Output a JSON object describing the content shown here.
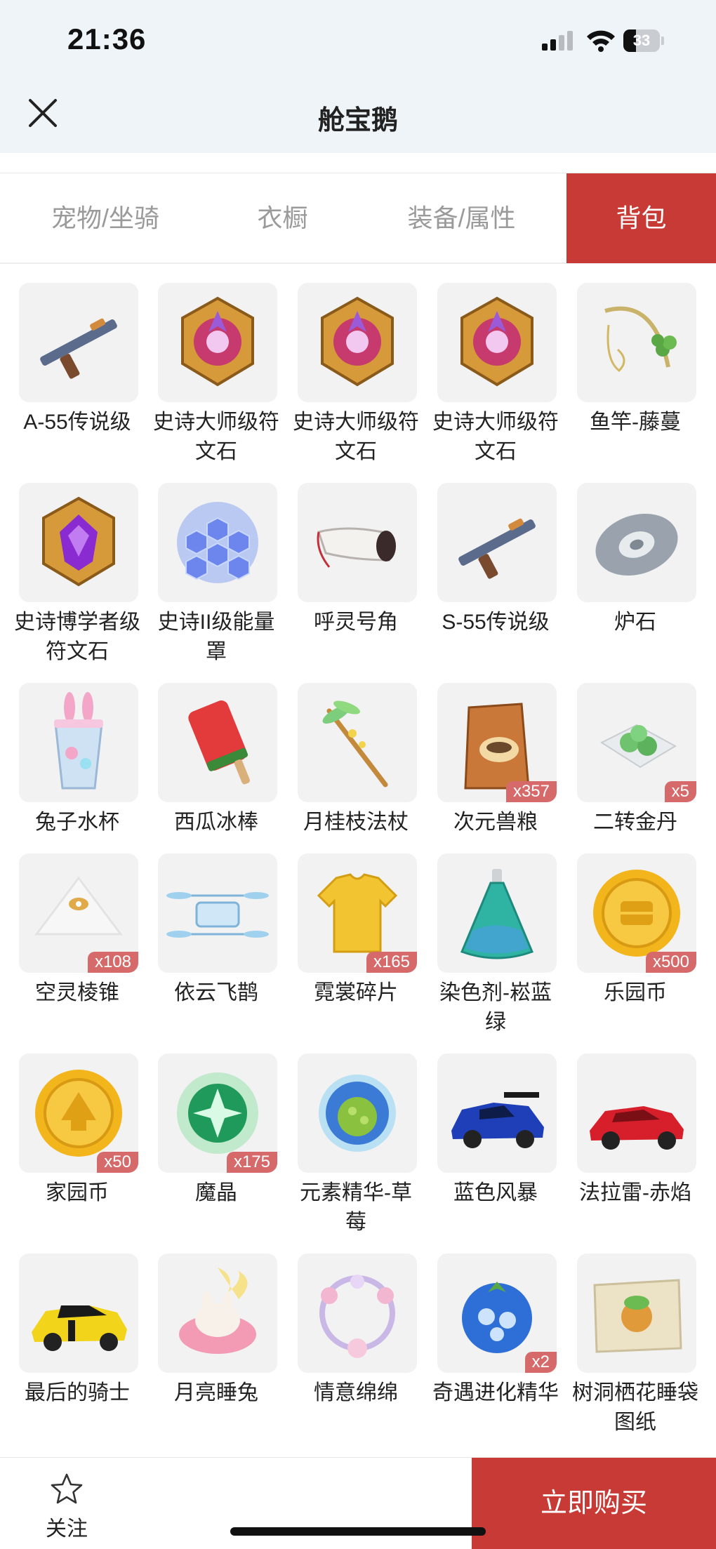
{
  "status": {
    "time": "21:36",
    "battery": "33"
  },
  "header": {
    "title": "舱宝鹅"
  },
  "tabs": [
    {
      "label": "宠物/坐骑",
      "active": false
    },
    {
      "label": "衣橱",
      "active": false
    },
    {
      "label": "装备/属性",
      "active": false
    },
    {
      "label": "背包",
      "active": true
    }
  ],
  "items": [
    {
      "name": "A-55传说级",
      "icon": "gun-icon",
      "badge": ""
    },
    {
      "name": "史诗大师级符文石",
      "icon": "rune-stone-icon",
      "badge": ""
    },
    {
      "name": "史诗大师级符文石",
      "icon": "rune-stone-icon",
      "badge": ""
    },
    {
      "name": "史诗大师级符文石",
      "icon": "rune-stone-icon",
      "badge": ""
    },
    {
      "name": "鱼竿-藤蔓",
      "icon": "fishing-rod-icon",
      "badge": ""
    },
    {
      "name": "史诗博学者级符文石",
      "icon": "purple-rune-icon",
      "badge": ""
    },
    {
      "name": "史诗II级能量罩",
      "icon": "energy-shield-icon",
      "badge": ""
    },
    {
      "name": "呼灵号角",
      "icon": "horn-icon",
      "badge": ""
    },
    {
      "name": "S-55传说级",
      "icon": "gun-icon",
      "badge": ""
    },
    {
      "name": "炉石",
      "icon": "hearthstone-icon",
      "badge": ""
    },
    {
      "name": "兔子水杯",
      "icon": "bunny-cup-icon",
      "badge": ""
    },
    {
      "name": "西瓜冰棒",
      "icon": "popsicle-icon",
      "badge": ""
    },
    {
      "name": "月桂枝法杖",
      "icon": "staff-icon",
      "badge": ""
    },
    {
      "name": "次元兽粮",
      "icon": "food-bag-icon",
      "badge": "x357"
    },
    {
      "name": "二转金丹",
      "icon": "pills-icon",
      "badge": "x5"
    },
    {
      "name": "空灵棱锥",
      "icon": "pyramid-icon",
      "badge": "x108"
    },
    {
      "name": "依云飞鹊",
      "icon": "drone-icon",
      "badge": ""
    },
    {
      "name": "霓裳碎片",
      "icon": "shirt-icon",
      "badge": "x165"
    },
    {
      "name": "染色剂-崧蓝绿",
      "icon": "dye-flask-icon",
      "badge": ""
    },
    {
      "name": "乐园币",
      "icon": "gold-coin-icon",
      "badge": "x500"
    },
    {
      "name": "家园币",
      "icon": "home-coin-icon",
      "badge": "x50"
    },
    {
      "name": "魔晶",
      "icon": "magic-crystal-icon",
      "badge": "x175"
    },
    {
      "name": "元素精华-草莓",
      "icon": "essence-orb-icon",
      "badge": ""
    },
    {
      "name": "蓝色风暴",
      "icon": "blue-car-icon",
      "badge": ""
    },
    {
      "name": "法拉雷-赤焰",
      "icon": "red-car-icon",
      "badge": ""
    },
    {
      "name": "最后的骑士",
      "icon": "yellow-car-icon",
      "badge": ""
    },
    {
      "name": "月亮睡兔",
      "icon": "sleeping-bunny-icon",
      "badge": ""
    },
    {
      "name": "情意绵绵",
      "icon": "floral-frame-icon",
      "badge": ""
    },
    {
      "name": "奇遇进化精华",
      "icon": "blueberry-icon",
      "badge": "x2"
    },
    {
      "name": "树洞栖花睡袋图纸",
      "icon": "blueprint-icon",
      "badge": ""
    }
  ],
  "footer": {
    "favorite_label": "关注",
    "buy_label": "立即购买"
  }
}
